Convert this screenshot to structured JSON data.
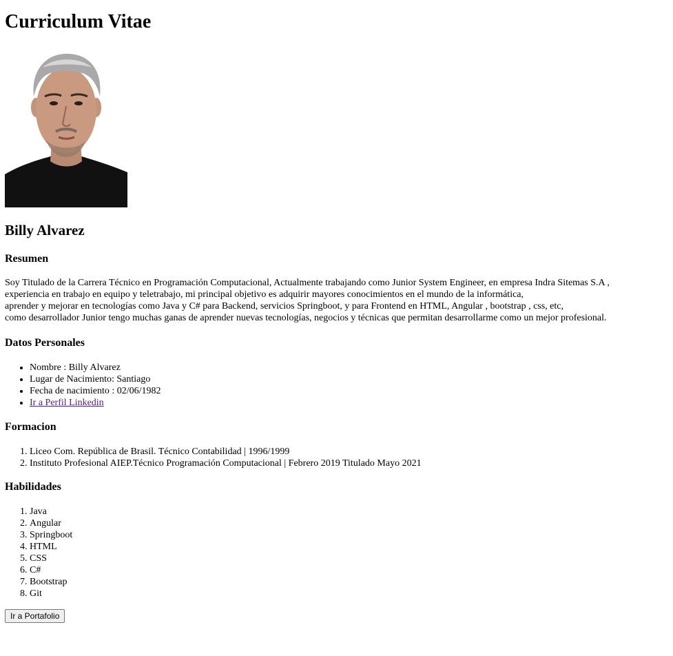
{
  "header": {
    "title": "Curriculum Vitae"
  },
  "profile": {
    "name": "Billy Alvarez"
  },
  "resumen": {
    "heading": "Resumen",
    "lines": [
      "Soy Titulado de la Carrera Técnico en Programación Computacional, Actualmente trabajando como Junior System Engineer, en empresa Indra Sitemas S.A ,",
      "experiencia en trabajo en equipo y teletrabajo, mi principal objetivo es adquirir mayores conocimientos en el mundo de la informática,",
      "aprender y mejorar en tecnologías como Java y C# para Backend, servicios Springboot, y para Frontend en HTML, Angular , bootstrap , css, etc,",
      "como desarrollador Junior tengo muchas ganas de aprender nuevas tecnologías, negocios y técnicas que permitan desarrollarme como un mejor profesional."
    ]
  },
  "datos": {
    "heading": "Datos Personales",
    "items": [
      "Nombre : Billy Alvarez",
      "Lugar de Nacimiento: Santiago",
      "Fecha de nacimiento : 02/06/1982"
    ],
    "link_label": "Ir a Perfil Linkedin"
  },
  "formacion": {
    "heading": "Formacion",
    "items": [
      "Liceo Com. República de Brasil. Técnico Contabilidad | 1996/1999",
      "Instituto Profesional AIEP.Técnico Programación Computacional | Febrero 2019 Titulado Mayo 2021"
    ]
  },
  "habilidades": {
    "heading": "Habilidades",
    "items": [
      "Java",
      "Angular",
      "Springboot",
      "HTML",
      "CSS",
      "C#",
      "Bootstrap",
      "Git"
    ]
  },
  "actions": {
    "portfolio_button": "Ir a Portafolio"
  },
  "colors": {
    "visited_link": "#551a8b",
    "button_bg": "#efefef",
    "button_border": "#767676"
  }
}
